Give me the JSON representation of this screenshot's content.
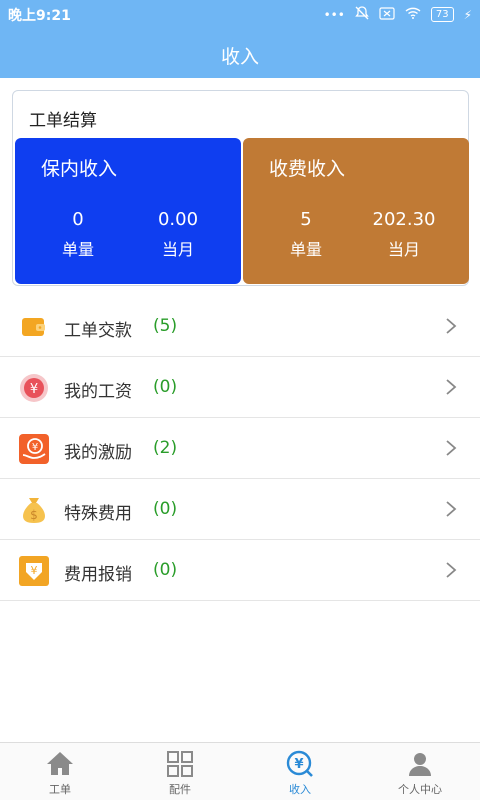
{
  "status": {
    "time": "晚上9:21",
    "battery": "73"
  },
  "header": {
    "title": "收入"
  },
  "card": {
    "title": "工单结算",
    "tiles": [
      {
        "title": "保内收入",
        "left_value": "0",
        "left_label": "单量",
        "right_value": "0.00",
        "right_label": "当月",
        "color": "#0f3ef0"
      },
      {
        "title": "收费收入",
        "left_value": "5",
        "left_label": "单量",
        "right_value": "202.30",
        "right_label": "当月",
        "color": "#c07a35"
      }
    ]
  },
  "list": [
    {
      "label": "工单交款",
      "count": "(5)",
      "icon": "wallet-icon"
    },
    {
      "label": "我的工资",
      "count": "(0)",
      "icon": "yen-coin-icon"
    },
    {
      "label": "我的激励",
      "count": "(2)",
      "icon": "reward-icon"
    },
    {
      "label": "特殊费用",
      "count": "(0)",
      "icon": "money-bag-icon"
    },
    {
      "label": "费用报销",
      "count": "(0)",
      "icon": "reimbursement-icon"
    }
  ],
  "nav": [
    {
      "label": "工单",
      "icon": "home-icon",
      "active": false
    },
    {
      "label": "配件",
      "icon": "grid-icon",
      "active": false
    },
    {
      "label": "收入",
      "icon": "income-icon",
      "active": true
    },
    {
      "label": "个人中心",
      "icon": "user-icon",
      "active": false
    }
  ],
  "colors": {
    "header": "#6fb6f4",
    "count_green": "#2a9d2a",
    "active_blue": "#2a8ad6"
  }
}
